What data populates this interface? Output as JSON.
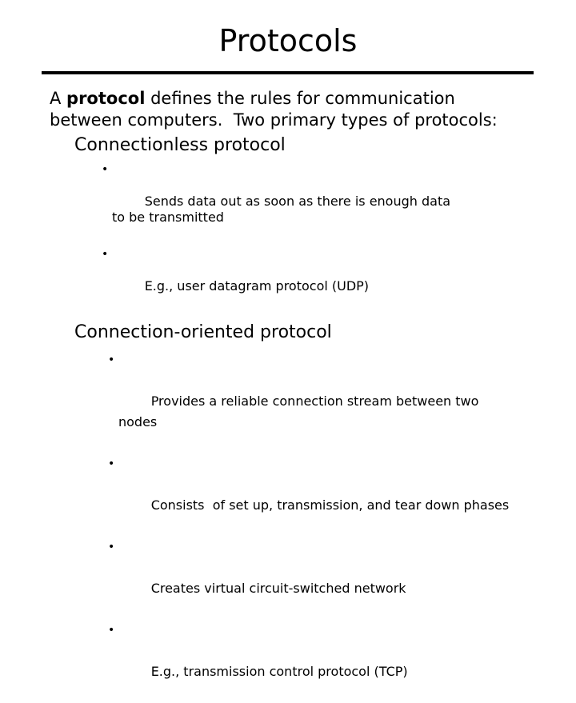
{
  "slide": {
    "title": "Protocols",
    "lead_paragraph": {
      "before_bold": "A ",
      "bold": "protocol",
      "after_bold": " defines the rules for communication between computers.  Two primary types of protocols:"
    },
    "sections": [
      {
        "heading": "Connectionless protocol",
        "bullet_char": "•",
        "bullets": [
          "Sends data out as soon as there is enough data to be transmitted",
          "E.g., user datagram protocol (UDP)"
        ]
      },
      {
        "heading": "Connection-oriented protocol",
        "bullet_char": "•",
        "bullets": [
          "Provides a reliable connection stream between two nodes",
          "Consists  of set up, transmission, and tear down phases",
          "Creates virtual circuit-switched network",
          "E.g., transmission control protocol (TCP)"
        ]
      }
    ],
    "colors": {
      "background": "#ffffff",
      "text": "#000000",
      "rule": "#000000"
    }
  }
}
